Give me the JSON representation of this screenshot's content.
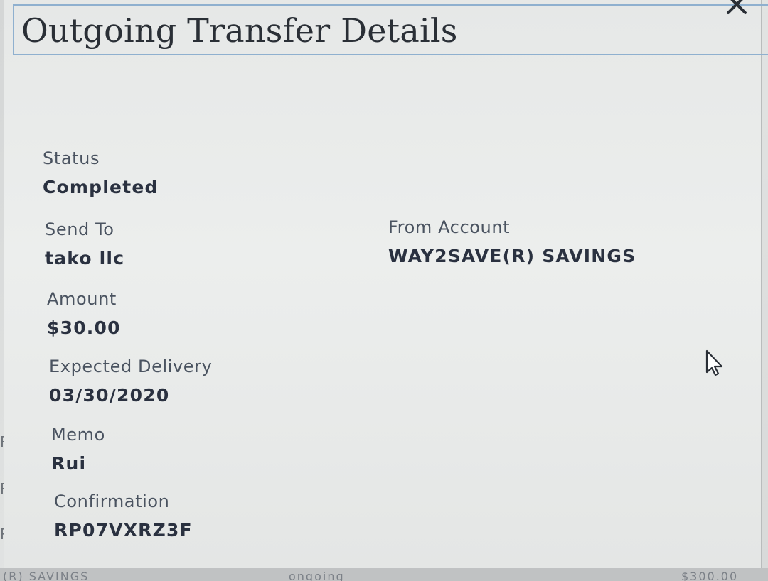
{
  "dialog": {
    "title": "Outgoing Transfer Details",
    "close_icon": "close-icon"
  },
  "fields": {
    "status": {
      "label": "Status",
      "value": "Completed"
    },
    "send_to": {
      "label": "Send To",
      "value": "tako llc"
    },
    "from_account": {
      "label": "From Account",
      "value": "WAY2SAVE(R) SAVINGS"
    },
    "amount": {
      "label": "Amount",
      "value": "$30.00"
    },
    "expected_delivery": {
      "label": "Expected Delivery",
      "value": "03/30/2020"
    },
    "memo": {
      "label": "Memo",
      "value": "Rui"
    },
    "confirmation": {
      "label": "Confirmation",
      "value": "RP07VXRZ3F"
    }
  },
  "background": {
    "left_fragment": "(R) SAVINGS",
    "mid_fragment": "ongoing",
    "right_fragment": "$300.00"
  },
  "colors": {
    "title_border": "#8fb0cf",
    "text_dark": "#2a3140",
    "text_label": "#4a5360"
  }
}
